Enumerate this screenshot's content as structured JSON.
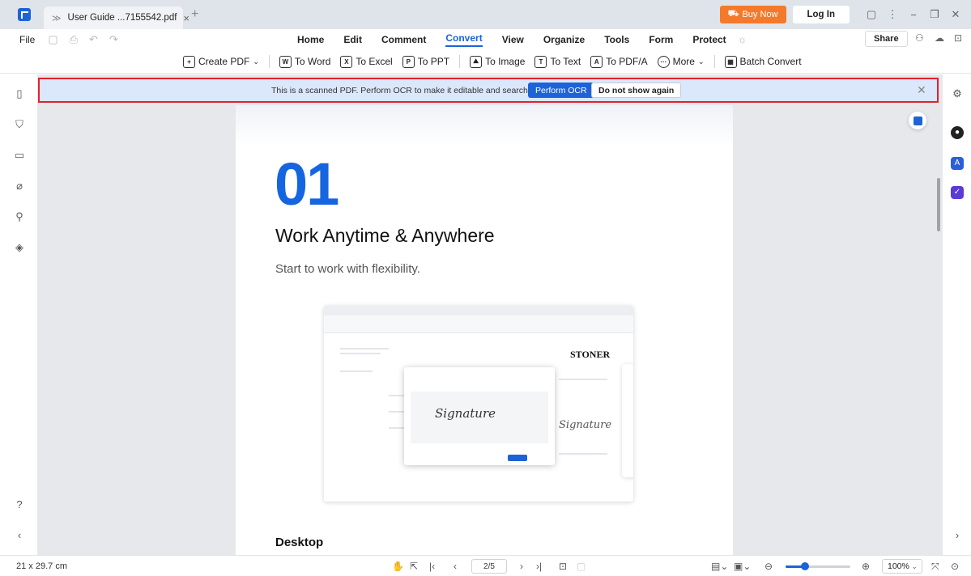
{
  "titlebar": {
    "tab_label": "User Guide ...7155542.pdf",
    "buy_label": "Buy Now",
    "login_label": "Log In"
  },
  "menubar": {
    "file_label": "File",
    "items": [
      "Home",
      "Edit",
      "Comment",
      "Convert",
      "View",
      "Organize",
      "Tools",
      "Form",
      "Protect"
    ],
    "active": "Convert",
    "share_label": "Share"
  },
  "toolbar": {
    "create_pdf": "Create PDF",
    "to_word": "To Word",
    "to_excel": "To Excel",
    "to_ppt": "To PPT",
    "to_image": "To Image",
    "to_text": "To Text",
    "to_pdfa": "To PDF/A",
    "more": "More",
    "batch_convert": "Batch Convert"
  },
  "banner": {
    "message": "This is a scanned PDF. Perform OCR to make it editable and searchable.",
    "ocr_button": "Perform OCR",
    "dismiss_button": "Do not show again"
  },
  "page": {
    "number": "01",
    "title": "Work Anytime & Anywhere",
    "subtitle": "Start to work with flexibility.",
    "section": "Desktop",
    "embedded_brand": "STONER"
  },
  "statusbar": {
    "dimensions": "21 x 29.7 cm",
    "page_indicator": "2/5",
    "zoom": "100%",
    "zoom_fraction": 0.3
  },
  "colors": {
    "accent": "#1c63d8",
    "buy": "#f47a2b",
    "banner_border": "#e3202d"
  }
}
